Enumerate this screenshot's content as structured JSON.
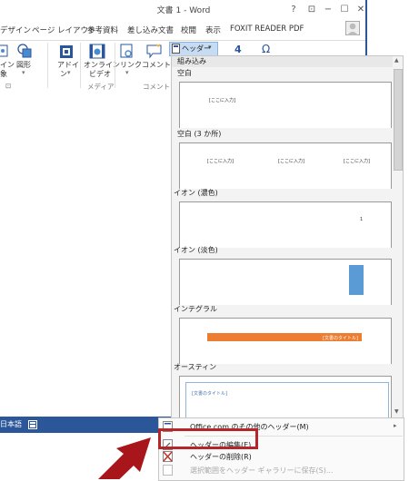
{
  "window": {
    "title": "文書 1 - Word",
    "help": "?",
    "ribbon_opts": "⊡",
    "minimize": "−",
    "maximize": "☐",
    "close": "✕"
  },
  "tabs": [
    "デザイン",
    "ページ レイアウト",
    "参考資料",
    "差し込み文書",
    "校閲",
    "表示",
    "FOXIT READER PDF"
  ],
  "ribbon": {
    "partial_line1": "イン",
    "partial_line2": "象",
    "shapes": "図形",
    "addins_line1": "アドイ",
    "addins_line2": "ン",
    "online_video_line1": "オンライン",
    "online_video_line2": "ビデオ",
    "link": "リンク",
    "comment": "コメント",
    "header_button": "ヘッダー",
    "group_media": "メディア",
    "group_comment": "コメント",
    "group_dialog": "⊡"
  },
  "status": {
    "language": "日本語"
  },
  "gallery": {
    "section": "組み込み",
    "templates": [
      {
        "label": "空白",
        "placeholders": [
          "[ここに入力]"
        ]
      },
      {
        "label": "空白 (3 か所)",
        "placeholders": [
          "[ここに入力]",
          "[ここに入力]",
          "[ここに入力]"
        ]
      },
      {
        "label": "イオン (濃色)",
        "placeholders": [
          "1"
        ]
      },
      {
        "label": "イオン (淡色)",
        "placeholders": []
      },
      {
        "label": "インテグラル",
        "placeholders": [
          "[文書のタイトル]"
        ]
      },
      {
        "label": "オースティン",
        "placeholders": [
          "[文書のタイトル]"
        ]
      }
    ]
  },
  "menu": {
    "items": [
      {
        "label": "Office.com のその他のヘッダー(M)",
        "enabled": true
      },
      {
        "label": "ヘッダーの編集(E)",
        "enabled": true
      },
      {
        "label": "ヘッダーの削除(R)",
        "enabled": true
      },
      {
        "label": "選択範囲をヘッダー ギャラリーに保存(S)...",
        "enabled": false
      }
    ]
  },
  "colors": {
    "word_blue": "#2b579a",
    "callout_red": "#b5262a",
    "arrow_red": "#a8161c",
    "ion_dark_blue": "#5b9bd5",
    "integral_orange": "#ed7d31"
  }
}
